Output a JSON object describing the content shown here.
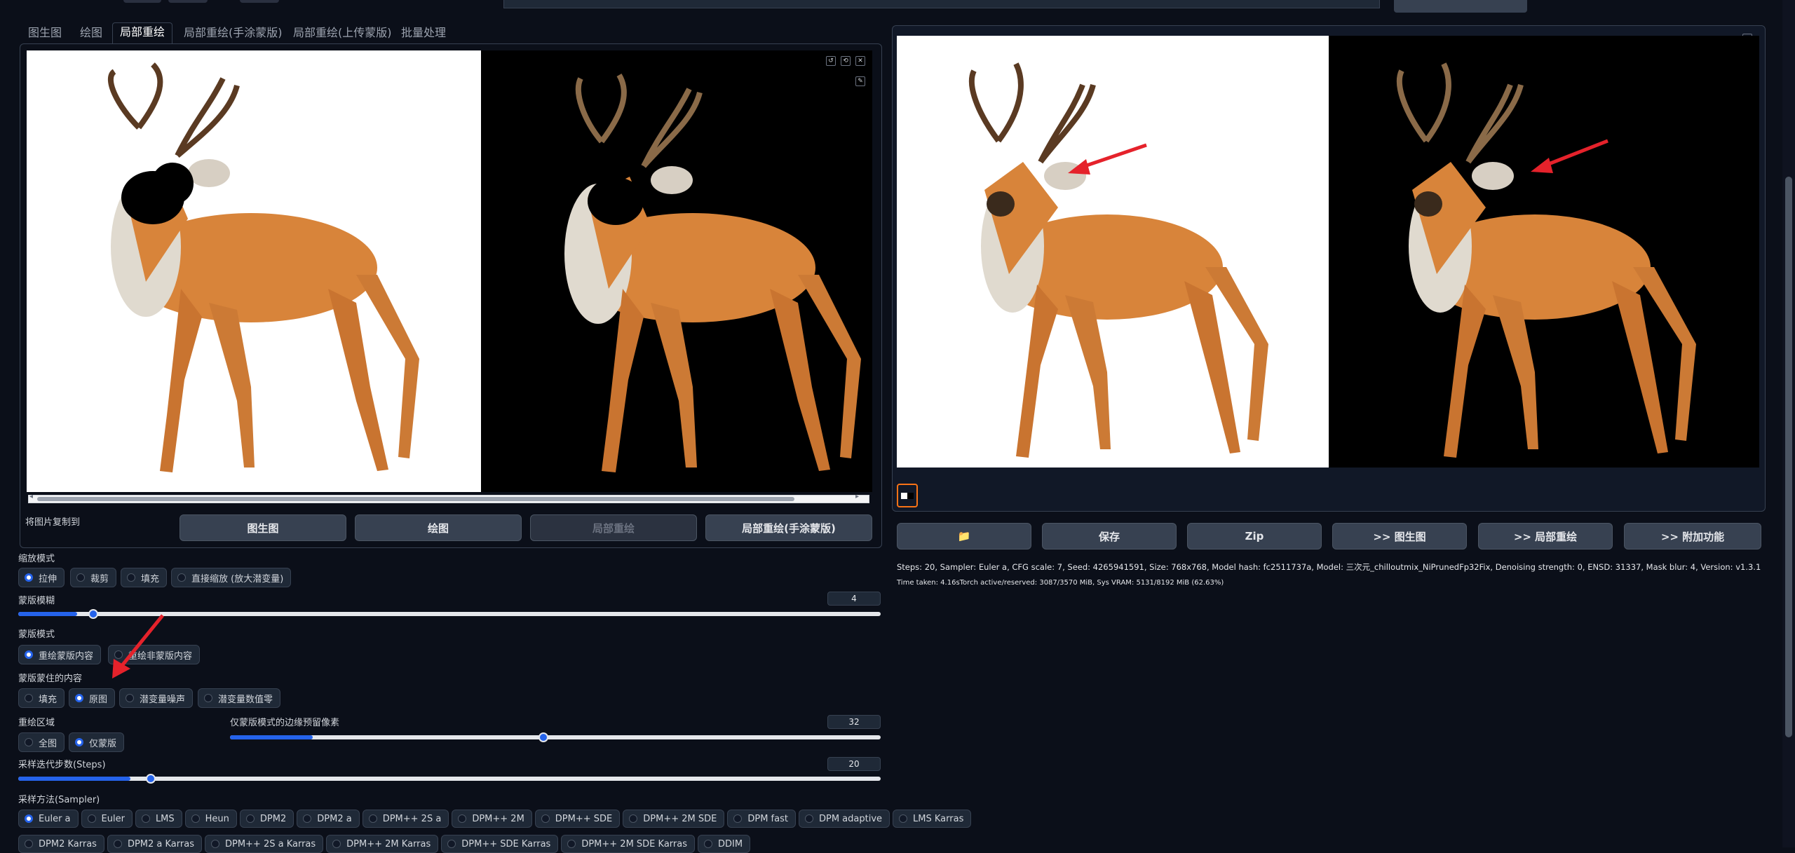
{
  "tabs": [
    "图生图",
    "绘图",
    "局部重绘",
    "局部重绘(手涂蒙版)",
    "局部重绘(上传蒙版)",
    "批量处理"
  ],
  "copy_to": {
    "label": "将图片复制到",
    "buttons": [
      "图生图",
      "绘图",
      "局部重绘",
      "局部重绘(手涂蒙版)"
    ]
  },
  "resize_mode": {
    "label": "缩放模式",
    "options": [
      "拉伸",
      "裁剪",
      "填充",
      "直接缩放 (放大潜变量)"
    ],
    "selected": 0
  },
  "mask_blur": {
    "label": "蒙版模糊",
    "value": 4,
    "max": 64
  },
  "mask_mode": {
    "label": "蒙版模式",
    "options": [
      "重绘蒙版内容",
      "重绘非蒙版内容"
    ],
    "selected": 0
  },
  "masked_content": {
    "label": "蒙版蒙住的内容",
    "options": [
      "填充",
      "原图",
      "潜变量噪声",
      "潜变量数值零"
    ],
    "selected": 1
  },
  "inpaint_area": {
    "label": "重绘区域",
    "options": [
      "全图",
      "仅蒙版"
    ],
    "selected": 1
  },
  "only_masked_padding": {
    "label": "仅蒙版模式的边缘预留像素",
    "value": 32,
    "max": 256
  },
  "steps": {
    "label": "采样迭代步数(Steps)",
    "value": 20,
    "max": 150
  },
  "sampler": {
    "label": "采样方法(Sampler)",
    "row1": [
      "Euler a",
      "Euler",
      "LMS",
      "Heun",
      "DPM2",
      "DPM2 a",
      "DPM++ 2S a",
      "DPM++ 2M",
      "DPM++ SDE",
      "DPM++ 2M SDE",
      "DPM fast",
      "DPM adaptive",
      "LMS Karras"
    ],
    "row2": [
      "DPM2 Karras",
      "DPM2 a Karras",
      "DPM++ 2S a Karras",
      "DPM++ 2M Karras",
      "DPM++ SDE Karras",
      "DPM++ 2M SDE Karras",
      "DDIM"
    ],
    "selected": "Euler a"
  },
  "output_buttons": [
    "📁",
    "保存",
    "Zip",
    ">> 图生图",
    ">> 局部重绘",
    ">> 附加功能"
  ],
  "gen_info": "Steps: 20, Sampler: Euler a, CFG scale: 7, Seed: 4265941591, Size: 768x768, Model hash: fc2511737a, Model: 三次元_chilloutmix_NiPrunedFp32Fix, Denoising strength: 0, ENSD: 31337, Mask blur: 4, Version: v1.3.1",
  "time_info": "Time taken: 4.16sTorch active/reserved: 3087/3570 MiB, Sys VRAM: 5131/8192 MiB (62.63%)",
  "icons": {
    "undo": "↺",
    "clear": "⟲",
    "close": "✕",
    "brush": "✎",
    "scroll_left": "◂",
    "scroll_right": "▸"
  },
  "colors": {
    "accent": "#2563eb",
    "annotation_arrow": "#e5222b",
    "thumbnail_border": "#f97316",
    "deer": "#d8843a"
  }
}
